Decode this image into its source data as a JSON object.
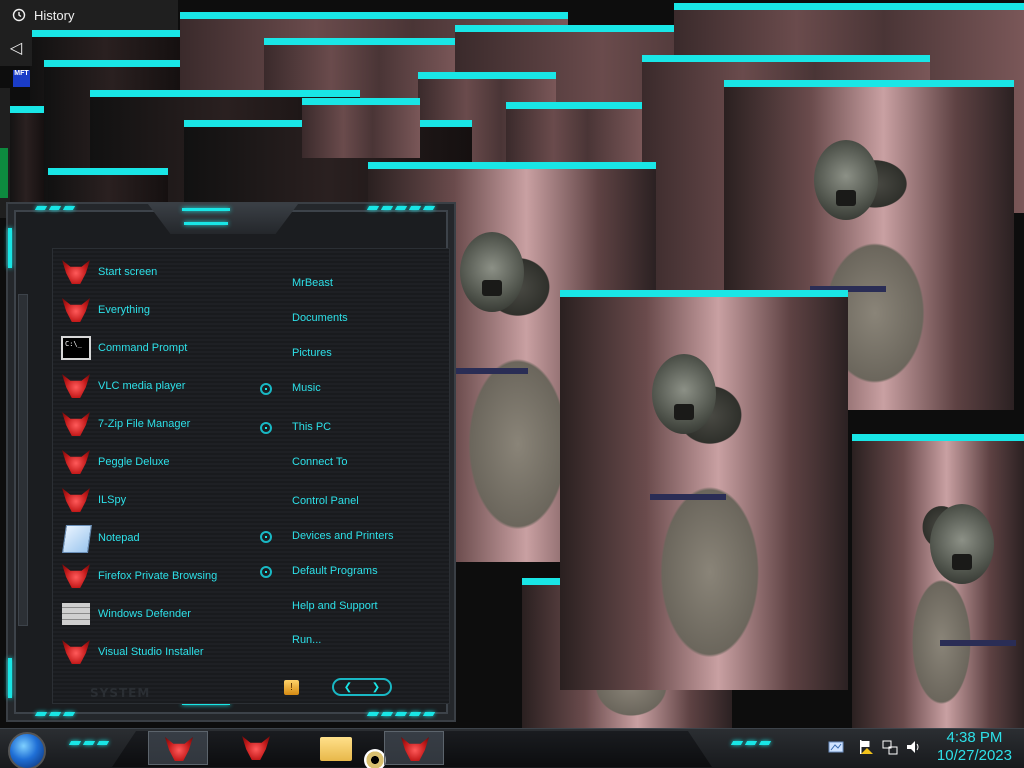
{
  "explorer": {
    "history_label": "History",
    "back_glyph": "◁",
    "mft_badge": "MFT"
  },
  "start_menu": {
    "programs": [
      {
        "label": "Start screen",
        "icon": "bull-icon"
      },
      {
        "label": "Everything",
        "icon": "bull-icon"
      },
      {
        "label": "Command Prompt",
        "icon": "cmd-icon"
      },
      {
        "label": "VLC media player",
        "icon": "bull-icon"
      },
      {
        "label": "7-Zip File Manager",
        "icon": "bull-icon"
      },
      {
        "label": "Peggle Deluxe",
        "icon": "bull-icon"
      },
      {
        "label": "ILSpy",
        "icon": "bull-icon"
      },
      {
        "label": "Notepad",
        "icon": "notepad-icon"
      },
      {
        "label": "Firefox Private Browsing",
        "icon": "bull-icon"
      },
      {
        "label": "Windows Defender",
        "icon": "defender-icon"
      },
      {
        "label": "Visual Studio Installer",
        "icon": "bull-icon"
      }
    ],
    "places": [
      "MrBeast",
      "Documents",
      "Pictures",
      "Music",
      "This PC",
      "Connect To",
      "Control Panel",
      "Devices and Printers",
      "Default Programs",
      "Help and Support",
      "Run..."
    ],
    "system_label": "SYSTEM",
    "cmd_icon_text": "C:\\_",
    "shutdown_glyph": "!",
    "arrow_left": "❮",
    "arrow_right": "❯"
  },
  "taskbar": {
    "clock_time": "4:38 PM",
    "clock_date": "10/27/2023"
  },
  "colors": {
    "accent_cyan": "#19e6e6",
    "menu_text": "#2de0e8",
    "bull_red": "#c41a1a"
  }
}
